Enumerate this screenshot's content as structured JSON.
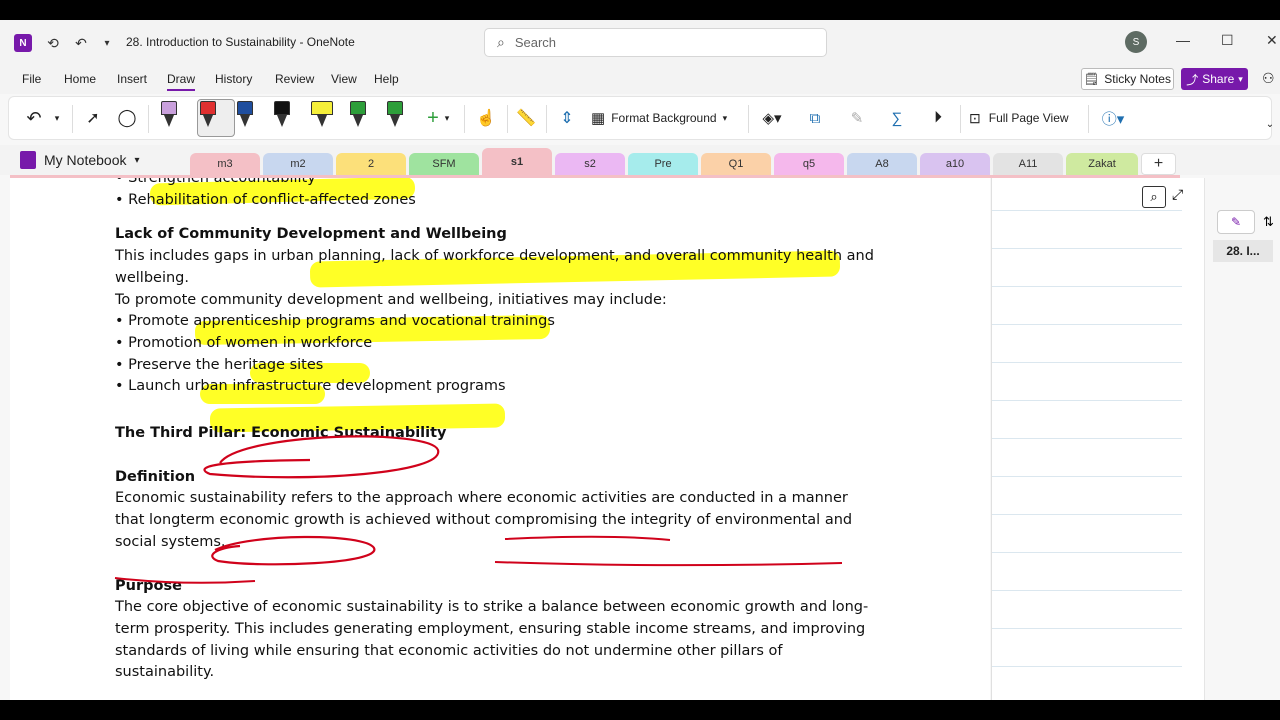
{
  "window": {
    "app_logo": "N",
    "title": "28. Introduction to Sustainability  -  OneNote",
    "search_placeholder": "Search",
    "avatar": "S"
  },
  "menu": [
    "File",
    "Home",
    "Insert",
    "Draw",
    "History",
    "Review",
    "View",
    "Help"
  ],
  "menu_active": "Draw",
  "header_buttons": {
    "sticky_notes": "Sticky Notes",
    "share": "Share"
  },
  "ribbon": {
    "format_background": "Format Background",
    "full_page_view": "Full Page View",
    "pen_colors": [
      "#c9a0dc",
      "#e03030",
      "#1f4e9e",
      "#111111",
      "#f5ef3a",
      "#2d9e3a",
      "#2d9e3a"
    ]
  },
  "notebook": {
    "name": "My Notebook",
    "tabs": [
      {
        "label": "m3",
        "color": "#f4c0c6"
      },
      {
        "label": "m2",
        "color": "#c8d7ef"
      },
      {
        "label": "2",
        "color": "#fce07a"
      },
      {
        "label": "SFM",
        "color": "#9fe39f"
      },
      {
        "label": "s1",
        "color": "#f4c0c6"
      },
      {
        "label": "s2",
        "color": "#ebb8f3"
      },
      {
        "label": "Pre",
        "color": "#a6ecec"
      },
      {
        "label": "Q1",
        "color": "#fbd1a8"
      },
      {
        "label": "q5",
        "color": "#f5b8ec"
      },
      {
        "label": "A8",
        "color": "#c8d7ef"
      },
      {
        "label": "a10",
        "color": "#d9c3f0"
      },
      {
        "label": "A11",
        "color": "#e3e3e3"
      },
      {
        "label": "Zakat",
        "color": "#cfeaa0"
      }
    ],
    "active_tab": "s1"
  },
  "page_list": {
    "current_page": "28. I..."
  },
  "notes": {
    "l1": "• Strengthen accountability",
    "l2": "• Rehabilitation of conflict-affected zones",
    "h1": "Lack of Community Development and Wellbeing",
    "l3": "This includes gaps in urban planning, lack of workforce development, and overall community health and",
    "l4": "wellbeing.",
    "l5": "To promote community development and wellbeing, initiatives may include:",
    "l6": "• Promote apprenticeship programs and vocational trainings",
    "l7": "• Promotion of women in workforce",
    "l8": "• Preserve the heritage sites",
    "l9": "• Launch urban infrastructure development programs",
    "h2": "The Third Pillar: Economic Sustainability",
    "h3": "Definition",
    "l10": "Economic sustainability refers to the approach where economic activities are conducted in a manner",
    "l11": "that longterm economic growth is achieved without compromising the integrity of environmental and",
    "l12": "social systems.",
    "h4": "Purpose",
    "l13": "The core objective of economic sustainability is to strike a balance between economic growth and long-",
    "l14": "term prosperity. This includes generating employment, ensuring stable income streams, and improving",
    "l15": "standards of living while ensuring that economic activities do not undermine other pillars of",
    "l16": "sustainability."
  },
  "colors": {
    "accent": "#7719aa",
    "highlighter": "#ffff00",
    "ink": "#d0021b"
  }
}
